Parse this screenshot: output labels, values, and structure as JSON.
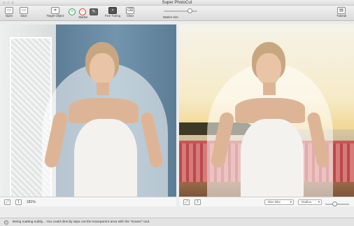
{
  "window": {
    "title": "Super PhotoCut"
  },
  "toolbar": {
    "open": "Open",
    "save": "Save",
    "target_object": "Target Object",
    "marker": "Marker",
    "fine_tuning": "Fine Tuning",
    "clear": "Clear",
    "marker_size": "Marker size",
    "tutorial": "Tutorial"
  },
  "left_pane": {
    "zoom": "181%"
  },
  "right_pane": {
    "blur_select": "Disc Blur",
    "radius_select": "Radius"
  },
  "status": {
    "message": "Being matting subtly... You could directly wipe out the transparent area with the \"Eraser\" tool."
  },
  "colors": {
    "accent_green": "#34a853",
    "accent_red": "#d93a2b",
    "railing": "#c75657"
  }
}
